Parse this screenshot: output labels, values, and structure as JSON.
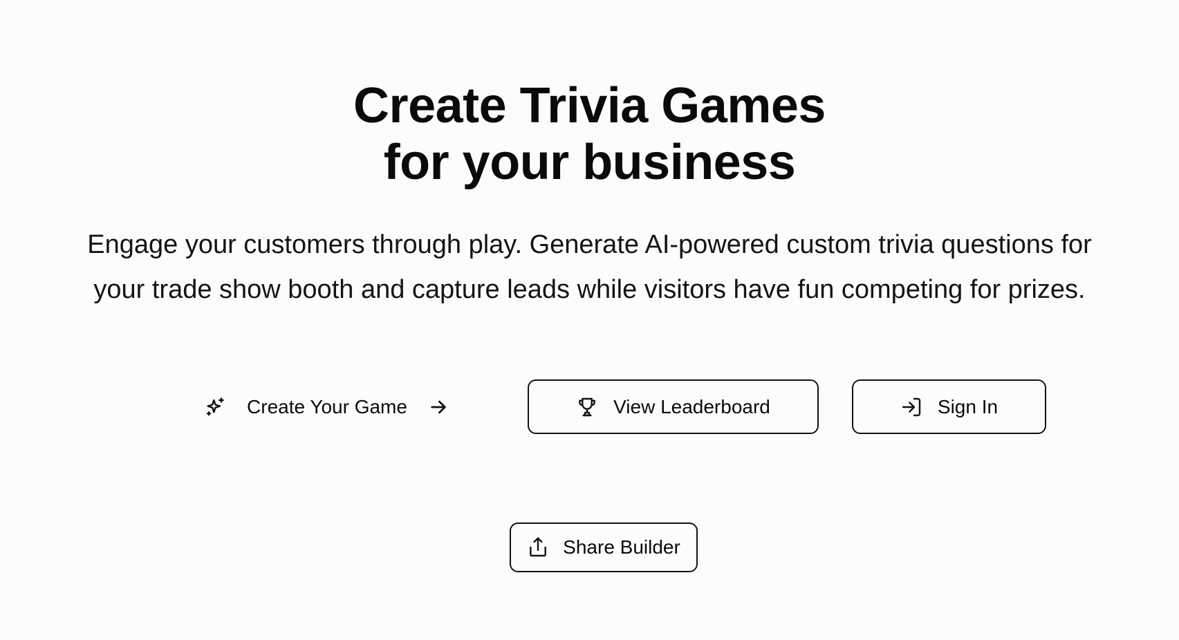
{
  "hero": {
    "title_line1": "Create Trivia Games",
    "title_line2": "for your business",
    "subtitle_line1": "Engage your customers through play. Generate AI-powered custom trivia questions for",
    "subtitle_line2": "your trade show booth and capture leads while visitors have fun competing for prizes."
  },
  "actions": {
    "create_game": {
      "label": "Create Your Game",
      "icon": "sparkles-icon",
      "trailing_icon": "arrow-right-icon"
    },
    "leaderboard": {
      "label": "View Leaderboard",
      "icon": "trophy-icon"
    },
    "sign_in": {
      "label": "Sign In",
      "icon": "log-in-icon"
    },
    "share": {
      "label": "Share Builder",
      "icon": "share-icon"
    }
  },
  "colors": {
    "background": "#fcfcfc",
    "text": "#0a0a0a",
    "border": "#111111"
  }
}
